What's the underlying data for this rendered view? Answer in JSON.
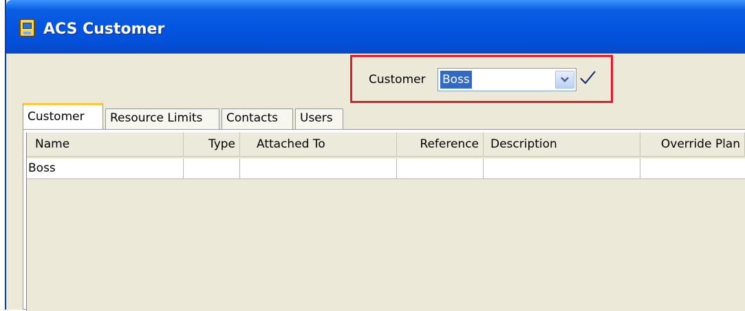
{
  "window": {
    "title": "ACS Customer",
    "icon": "computer-app-icon"
  },
  "selector": {
    "label": "Customer",
    "value": "Boss",
    "dropdown_icon": "chevron-down-icon",
    "confirm_icon": "checkmark-icon",
    "highlight_color": "#e01b2b"
  },
  "tabs": [
    {
      "label": "Customer",
      "active": true
    },
    {
      "label": "Resource Limits",
      "active": false
    },
    {
      "label": "Contacts",
      "active": false
    },
    {
      "label": "Users",
      "active": false
    }
  ],
  "table": {
    "columns": [
      "Name",
      "Type",
      "Attached To",
      "Reference",
      "Description",
      "Override Plan"
    ],
    "rows": [
      [
        "Boss",
        "",
        "",
        "",
        "",
        ""
      ]
    ]
  }
}
